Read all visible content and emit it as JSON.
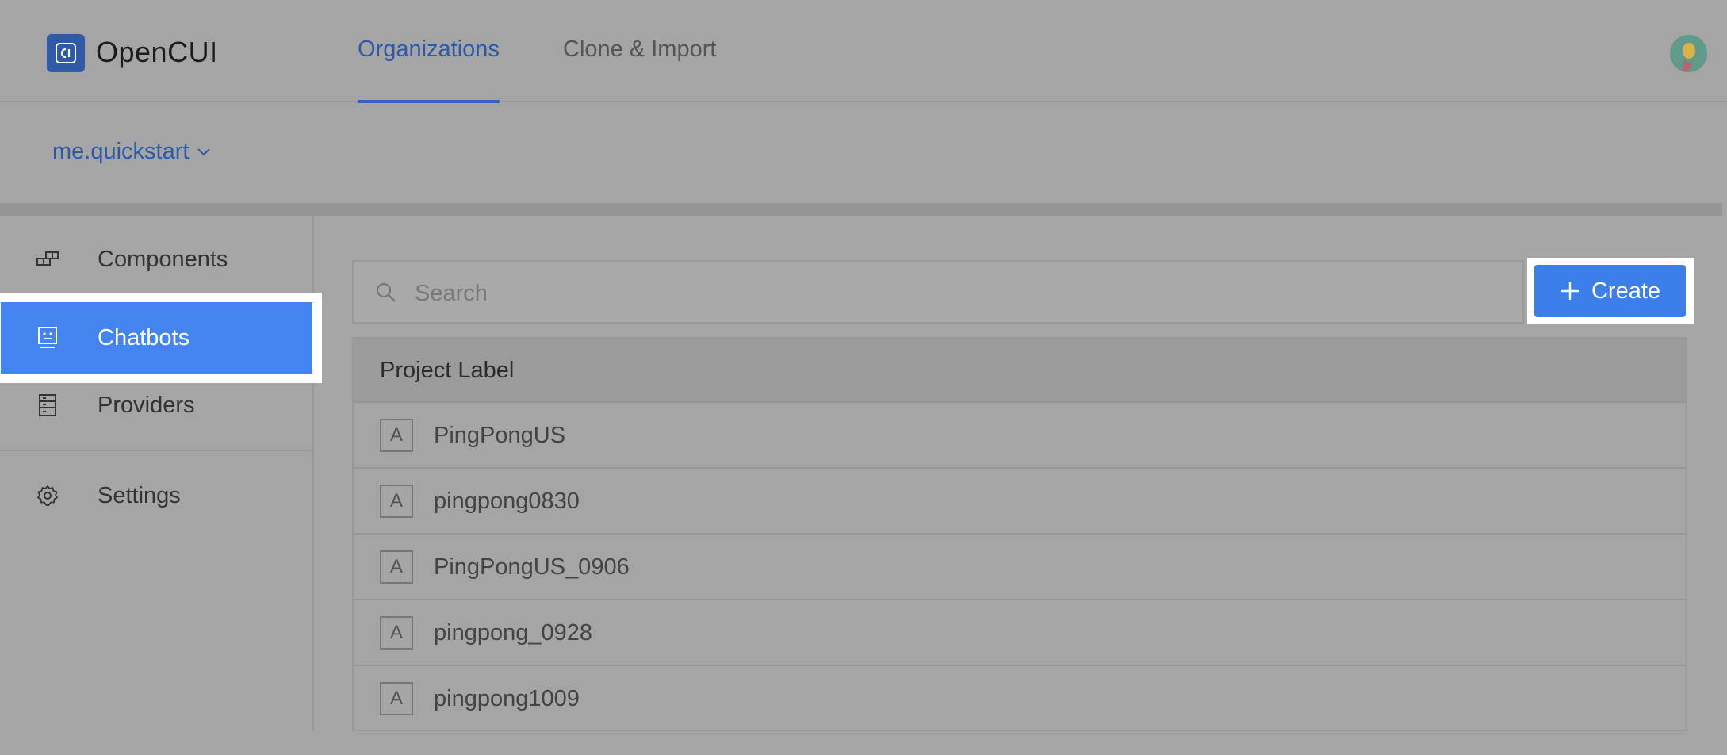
{
  "header": {
    "brand": "OpenCUI",
    "nav_tabs": [
      {
        "label": "Organizations",
        "active": true
      },
      {
        "label": "Clone & Import",
        "active": false
      }
    ]
  },
  "org": {
    "selected": "me.quickstart"
  },
  "sidebar": {
    "items": [
      {
        "label": "Components",
        "icon": "components-icon",
        "active": false
      },
      {
        "label": "Chatbots",
        "icon": "chatbot-icon",
        "active": true
      },
      {
        "label": "Providers",
        "icon": "providers-icon",
        "active": false
      },
      {
        "label": "Settings",
        "icon": "gear-icon",
        "active": false
      }
    ]
  },
  "search": {
    "placeholder": "Search"
  },
  "create_button": {
    "label": "Create"
  },
  "table": {
    "header": "Project Label",
    "rows": [
      {
        "badge": "A",
        "name": "PingPongUS"
      },
      {
        "badge": "A",
        "name": "pingpong0830"
      },
      {
        "badge": "A",
        "name": "PingPongUS_0906"
      },
      {
        "badge": "A",
        "name": "pingpong_0928"
      },
      {
        "badge": "A",
        "name": "pingpong1009"
      }
    ]
  },
  "colors": {
    "accent": "#4384ef",
    "link": "#2d59a6",
    "overlay_bg": "#a5a5a5"
  }
}
